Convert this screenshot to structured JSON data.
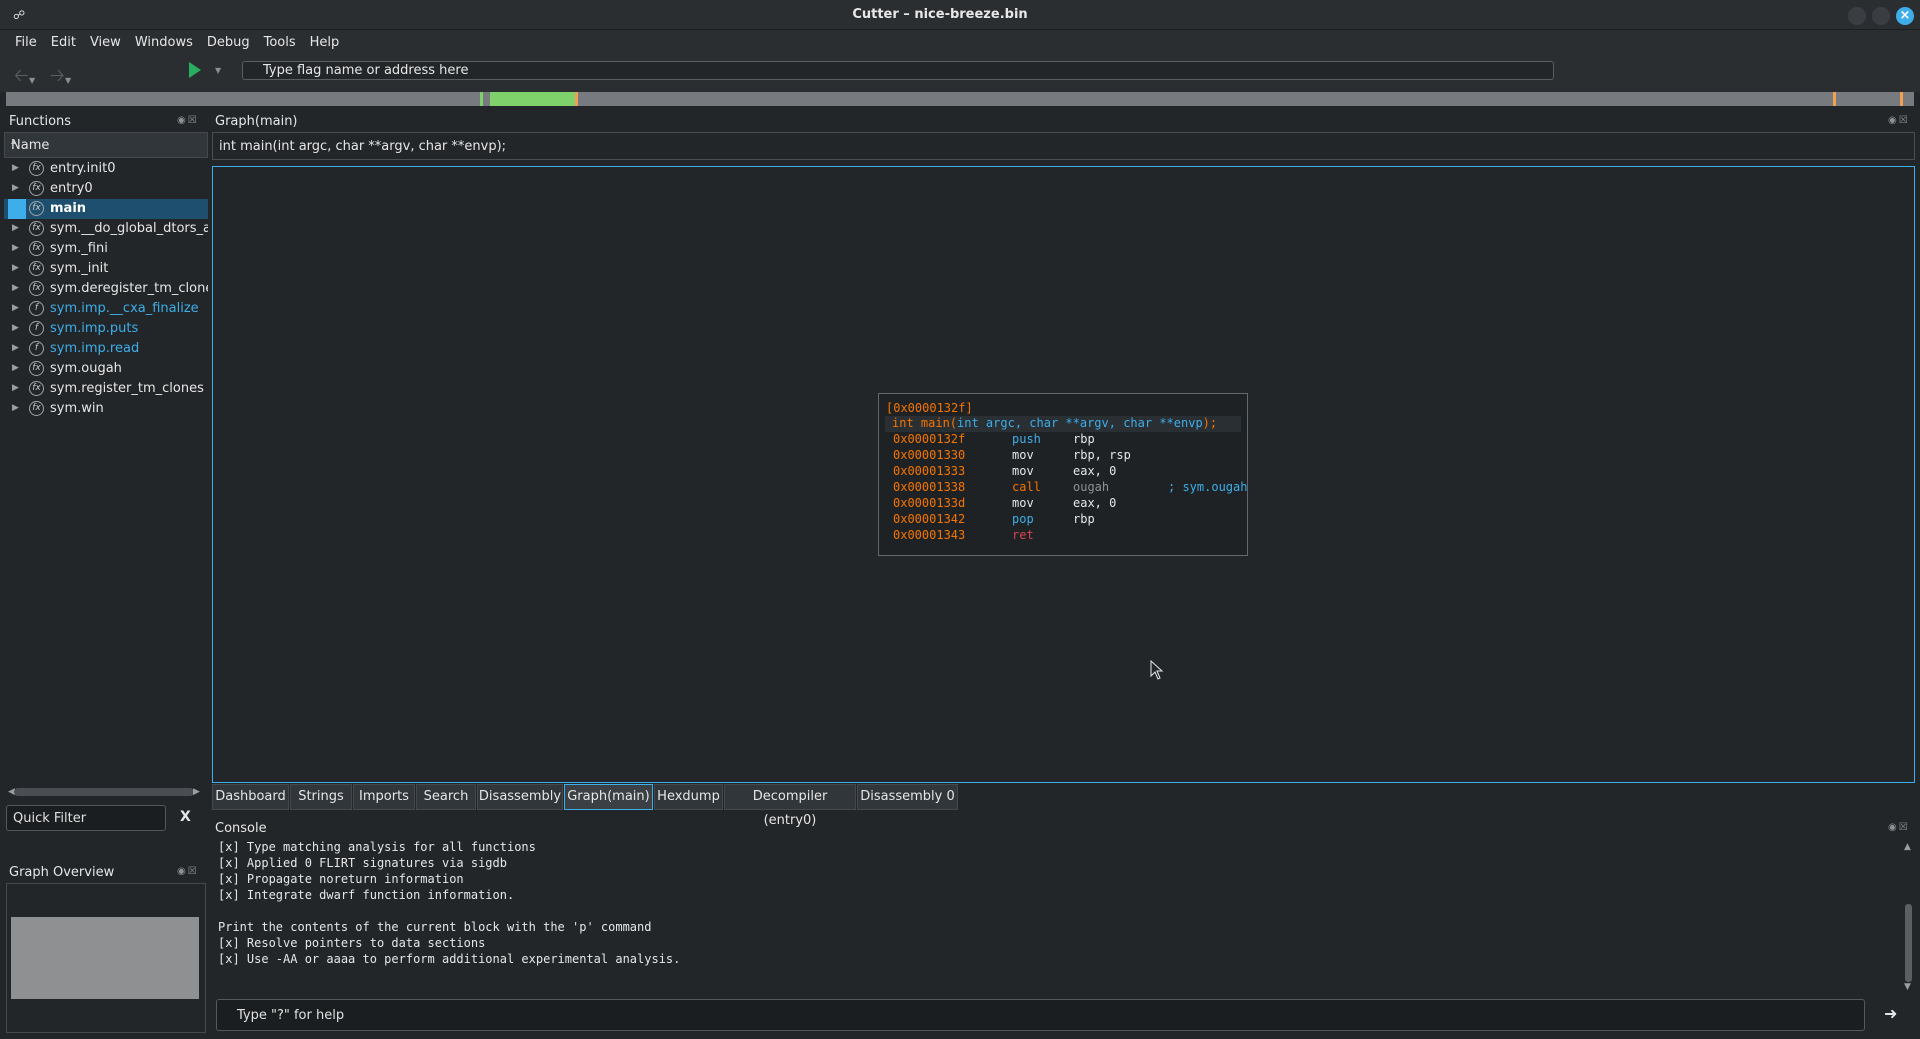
{
  "window": {
    "title": "Cutter – nice-breeze.bin"
  },
  "menu": [
    "File",
    "Edit",
    "View",
    "Windows",
    "Debug",
    "Tools",
    "Help"
  ],
  "toolbar": {
    "address_placeholder": "Type flag name or address here"
  },
  "colors": {
    "accent": "#3daee9",
    "address": "#f67400",
    "navbar_code": "#7fd16b",
    "navbar_base": "#777b7f"
  },
  "functions": {
    "title": "Functions",
    "column_header": "Name",
    "items": [
      {
        "name": "entry.init0",
        "type": "function"
      },
      {
        "name": "entry0",
        "type": "function"
      },
      {
        "name": "main",
        "type": "function",
        "selected": true
      },
      {
        "name": "sym.__do_global_dtors_au",
        "type": "function"
      },
      {
        "name": "sym._fini",
        "type": "function"
      },
      {
        "name": "sym._init",
        "type": "function"
      },
      {
        "name": "sym.deregister_tm_clones",
        "type": "function"
      },
      {
        "name": "sym.imp.__cxa_finalize",
        "type": "import"
      },
      {
        "name": "sym.imp.puts",
        "type": "import"
      },
      {
        "name": "sym.imp.read",
        "type": "import"
      },
      {
        "name": "sym.ougah",
        "type": "function"
      },
      {
        "name": "sym.register_tm_clones",
        "type": "function"
      },
      {
        "name": "sym.win",
        "type": "function"
      }
    ],
    "quick_filter_placeholder": "Quick Filter",
    "quick_filter_clear": "X"
  },
  "graph_overview": {
    "title": "Graph Overview"
  },
  "graph": {
    "title": "Graph(main)",
    "signature": "int main(int argc, char **argv, char **envp);",
    "block": {
      "header": "[0x0000132f]",
      "sig_prefix": "int main(",
      "sig_args": "int argc, char **argv, char **envp",
      "sig_suffix": ");",
      "instructions": [
        {
          "addr": "0x0000132f",
          "mnemonic": "push",
          "operands": "rbp",
          "color": "#3daee9",
          "comment": ""
        },
        {
          "addr": "0x00001330",
          "mnemonic": "mov",
          "operands": "rbp, rsp",
          "color": "#e6e6e6",
          "comment": ""
        },
        {
          "addr": "0x00001333",
          "mnemonic": "mov",
          "operands": "eax, 0",
          "color": "#e6e6e6",
          "comment": ""
        },
        {
          "addr": "0x00001338",
          "mnemonic": "call",
          "operands": "ougah",
          "color": "#f67400",
          "comment": "; sym.ougah"
        },
        {
          "addr": "0x0000133d",
          "mnemonic": "mov",
          "operands": "eax, 0",
          "color": "#e6e6e6",
          "comment": ""
        },
        {
          "addr": "0x00001342",
          "mnemonic": "pop",
          "operands": "rbp",
          "color": "#3daee9",
          "comment": ""
        },
        {
          "addr": "0x00001343",
          "mnemonic": "ret",
          "operands": "",
          "color": "#da4453",
          "comment": ""
        }
      ]
    }
  },
  "tabs": [
    "Dashboard",
    "Strings",
    "Imports",
    "Search",
    "Disassembly",
    "Graph(main)",
    "Hexdump",
    "Decompiler (entry0)",
    "Disassembly 0"
  ],
  "active_tab": "Graph(main)",
  "console": {
    "title": "Console",
    "lines": [
      "[x] Type matching analysis for all functions",
      "[x] Applied 0 FLIRT signatures via sigdb",
      "[x] Propagate noreturn information",
      "[x] Integrate dwarf function information.",
      "",
      "Print the contents of the current block with the 'p' command",
      "[x] Resolve pointers to data sections",
      "[x] Use -AA or aaaa to perform additional experimental analysis."
    ],
    "input_placeholder": "Type \"?\" for help"
  }
}
